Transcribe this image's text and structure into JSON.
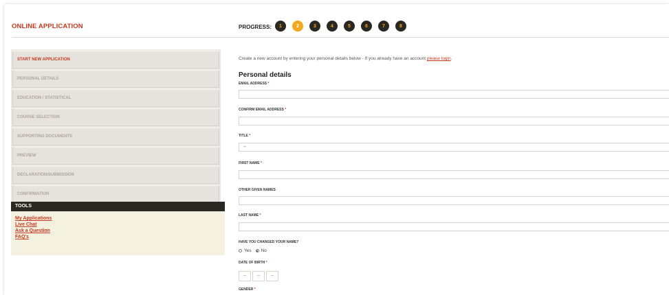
{
  "header": {
    "app_title": "ONLINE APPLICATION",
    "progress_label": "PROGRESS:",
    "steps": [
      "1",
      "2",
      "3",
      "4",
      "5",
      "6",
      "7",
      "8"
    ],
    "active_step": "2"
  },
  "sidebar": {
    "items": [
      "START NEW APPLICATION",
      "PERSONAL DETAILS",
      "EDUCATION / STATISTICAL",
      "COURSE SELECTION",
      "SUPPORTING DOCUMENTS",
      "PREVIEW",
      "DECLARATION/SUBMISSION",
      "CONFIRMATION"
    ],
    "current_item": "START NEW APPLICATION"
  },
  "tools": {
    "title": "TOOLS",
    "links": [
      "My Applications",
      "Live Chat",
      "Ask a Question",
      "FAQ's"
    ]
  },
  "main": {
    "intro_text": "Create a new account by entering your personal details below - If you already have an account ",
    "intro_link": "please login",
    "intro_end": ".",
    "section_title": "Personal details",
    "required_mark": "*",
    "fields": {
      "email_label": "EMAIL ADDRESS",
      "confirm_email_label": "CONFIRM EMAIL ADDRESS",
      "title_label": "TITLE",
      "title_value": "--",
      "first_name_label": "FIRST NAME",
      "other_names_label": "OTHER GIVEN NAMES",
      "last_name_label": "LAST NAME",
      "changed_name_label": "HAVE YOU CHANGED YOUR NAME?",
      "yes_label": "Yes",
      "no_label": "No",
      "dob_label": "DATE OF BIRTH",
      "dob_day": "--",
      "dob_month": "--",
      "dob_year": "--",
      "gender_label": "GENDER"
    }
  }
}
